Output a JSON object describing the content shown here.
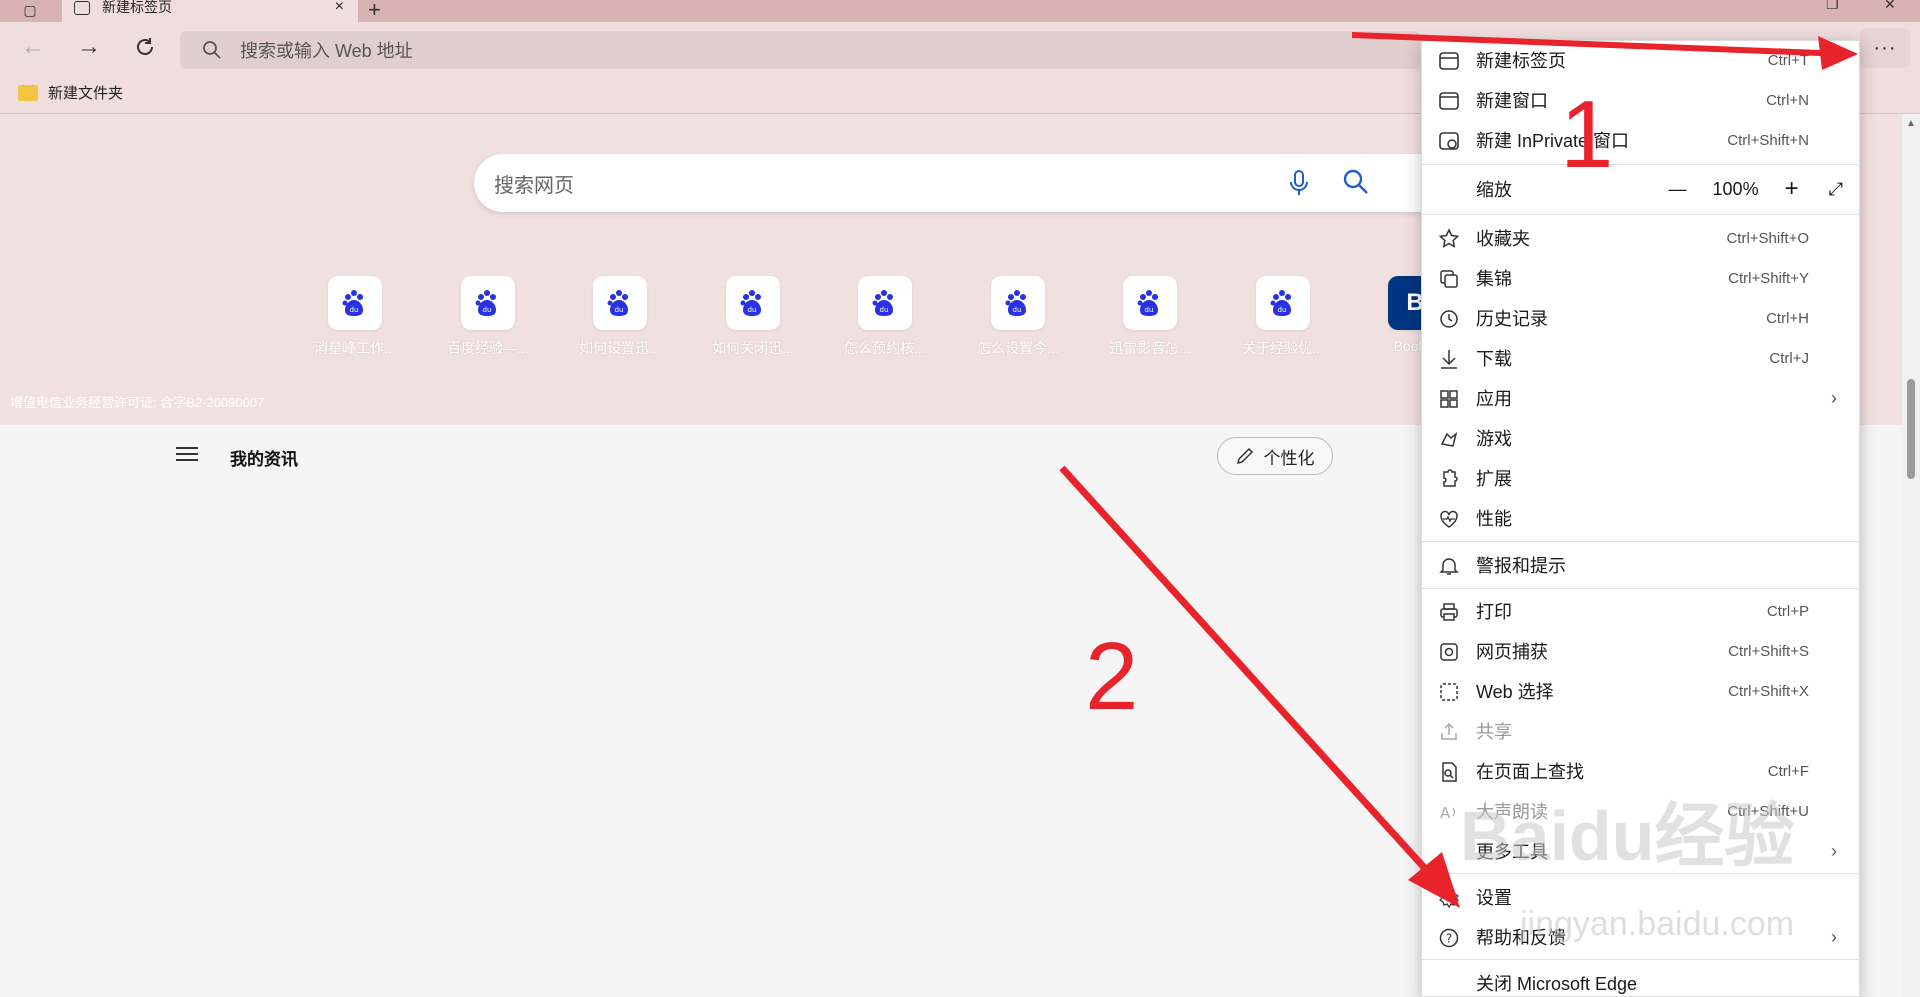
{
  "tabbar": {
    "tab_title": "新建标签页",
    "close": "×",
    "new_tab": "+"
  },
  "toolbar": {
    "address_placeholder": "搜索或输入 Web 地址",
    "more": "···"
  },
  "favorites": {
    "folder": "新建文件夹"
  },
  "hero": {
    "search_placeholder": "搜索网页",
    "quick_links": [
      "消星峰工作...",
      "百度经验—...",
      "如何设置迅...",
      "如何关闭迅...",
      "怎么预约核...",
      "怎么设置今...",
      "迅雷影音怎...",
      "关于经验优...",
      "Bookin"
    ],
    "license": "增值电信业务经营许可证: 合字B2-20090007"
  },
  "feed": {
    "my_news": "我的资讯",
    "personalize": "个性化"
  },
  "menu": {
    "items": [
      {
        "label": "新建标签页",
        "shortcut": "Ctrl+T"
      },
      {
        "label": "新建窗口",
        "shortcut": "Ctrl+N"
      },
      {
        "label": "新建 InPrivate 窗口",
        "shortcut": "Ctrl+Shift+N"
      },
      {
        "label": "缩放",
        "zoom": "100%"
      },
      {
        "label": "收藏夹",
        "shortcut": "Ctrl+Shift+O"
      },
      {
        "label": "集锦",
        "shortcut": "Ctrl+Shift+Y"
      },
      {
        "label": "历史记录",
        "shortcut": "Ctrl+H"
      },
      {
        "label": "下载",
        "shortcut": "Ctrl+J"
      },
      {
        "label": "应用",
        "chevron": "›"
      },
      {
        "label": "游戏"
      },
      {
        "label": "扩展"
      },
      {
        "label": "性能"
      },
      {
        "label": "警报和提示"
      },
      {
        "label": "打印",
        "shortcut": "Ctrl+P"
      },
      {
        "label": "网页捕获",
        "shortcut": "Ctrl+Shift+S"
      },
      {
        "label": "Web 选择",
        "shortcut": "Ctrl+Shift+X"
      },
      {
        "label": "共享"
      },
      {
        "label": "在页面上查找",
        "shortcut": "Ctrl+F"
      },
      {
        "label": "大声朗读",
        "shortcut": "Ctrl+Shift+U"
      },
      {
        "label": "更多工具",
        "chevron": "›"
      },
      {
        "label": "设置"
      },
      {
        "label": "帮助和反馈",
        "chevron": "›"
      },
      {
        "label": "关闭 Microsoft Edge"
      }
    ],
    "zoom_minus": "—",
    "zoom_plus": "+"
  },
  "annotations": {
    "one": "1",
    "two": "2"
  },
  "watermark": {
    "brand": "Baidu经验",
    "url": "jingyan.baidu.com"
  },
  "colors": {
    "annotation_red": "#e8232b",
    "baidu_blue": "#2932e1"
  }
}
